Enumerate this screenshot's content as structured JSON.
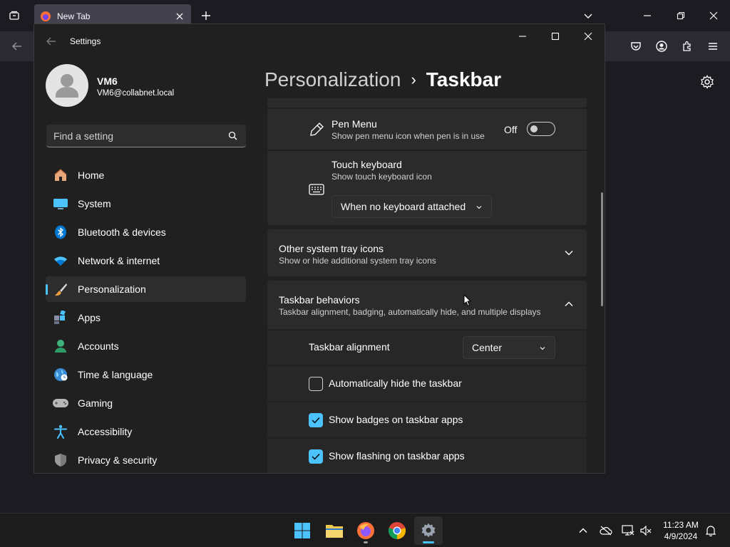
{
  "browser": {
    "tab_title": "New Tab"
  },
  "window": {
    "app_title": "Settings"
  },
  "profile": {
    "name": "VM6",
    "email": "VM6@collabnet.local"
  },
  "search": {
    "placeholder": "Find a setting"
  },
  "nav": {
    "items": [
      {
        "label": "Home",
        "icon": "home-icon"
      },
      {
        "label": "System",
        "icon": "system-icon"
      },
      {
        "label": "Bluetooth & devices",
        "icon": "bluetooth-icon"
      },
      {
        "label": "Network & internet",
        "icon": "wifi-icon"
      },
      {
        "label": "Personalization",
        "icon": "brush-icon",
        "active": true
      },
      {
        "label": "Apps",
        "icon": "apps-icon"
      },
      {
        "label": "Accounts",
        "icon": "accounts-icon"
      },
      {
        "label": "Time & language",
        "icon": "globe-icon"
      },
      {
        "label": "Gaming",
        "icon": "gamepad-icon"
      },
      {
        "label": "Accessibility",
        "icon": "accessibility-icon"
      },
      {
        "label": "Privacy & security",
        "icon": "shield-icon"
      }
    ]
  },
  "breadcrumb": {
    "parent": "Personalization",
    "separator": "›",
    "current": "Taskbar"
  },
  "settings": {
    "pen_menu": {
      "title": "Pen Menu",
      "subtitle": "Show pen menu icon when pen is in use",
      "state": "Off"
    },
    "touch_keyboard": {
      "title": "Touch keyboard",
      "subtitle": "Show touch keyboard icon",
      "value": "When no keyboard attached"
    },
    "other_tray": {
      "title": "Other system tray icons",
      "subtitle": "Show or hide additional system tray icons"
    },
    "behaviors": {
      "title": "Taskbar behaviors",
      "subtitle": "Taskbar alignment, badging, automatically hide, and multiple displays",
      "alignment_label": "Taskbar alignment",
      "alignment_value": "Center",
      "auto_hide": {
        "label": "Automatically hide the taskbar",
        "checked": false
      },
      "badges": {
        "label": "Show badges on taskbar apps",
        "checked": true
      },
      "flashing": {
        "label": "Show flashing on taskbar apps",
        "checked": true
      }
    }
  },
  "taskbar": {
    "time": "11:23 AM",
    "date": "4/9/2024"
  },
  "colors": {
    "accent": "#4cc2ff",
    "window_bg": "#202020",
    "card_bg": "#2b2b2b"
  }
}
